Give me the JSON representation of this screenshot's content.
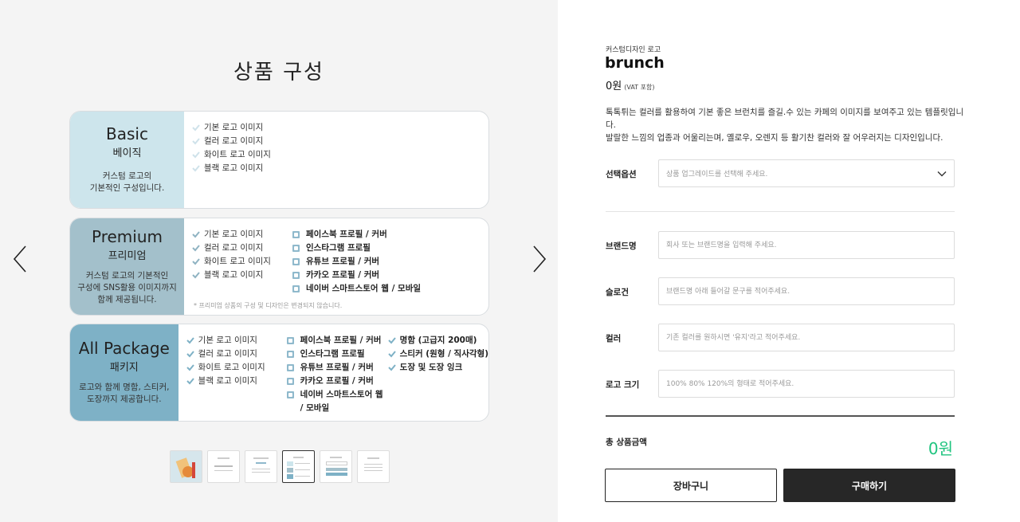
{
  "gallery": {
    "title": "상품 구성",
    "cards": [
      {
        "name_en": "Basic",
        "name_ko": "베이직",
        "desc_lines": [
          "커스텀 로고의",
          "기본적인 구성입니다."
        ],
        "items": [
          "기본 로고 이미지",
          "컬러 로고 이미지",
          "화이트 로고 이미지",
          "블랙 로고 이미지"
        ]
      },
      {
        "name_en": "Premium",
        "name_ko": "프리미엄",
        "desc_lines": [
          "커스텀 로고의 기본적인",
          "구성에 SNS활용 이미지까지",
          "함께 제공됩니다."
        ],
        "items": [
          "기본 로고 이미지",
          "컬러 로고 이미지",
          "화이트 로고 이미지",
          "블랙 로고 이미지"
        ],
        "sns_items": [
          "페이스북 프로필 / 커버",
          "인스타그램 프로필",
          "유튜브 프로필 / 커버",
          "카카오 프로필 / 커버",
          "네이버 스마트스토어 웹 / 모바일"
        ],
        "note": "* 프리미엄 상품의 구성 및 디자인은 변경되지 않습니다."
      },
      {
        "name_en": "All Package",
        "name_ko": "패키지",
        "desc_lines": [
          "로고와 함께 명함, 스티커,",
          "도장까지 제공합니다."
        ],
        "items": [
          "기본 로고 이미지",
          "컬러 로고 이미지",
          "화이트 로고 이미지",
          "블랙 로고 이미지"
        ],
        "sns_items": [
          "페이스북 프로필 / 커버",
          "인스타그램 프로필",
          "유튜브 프로필 / 커버",
          "카카오 프로필 / 커버",
          "네이버 스마트스토어 웹 / 모바일"
        ],
        "extra_items": [
          "명함 (고급지 200매)",
          "스티커 (원형 / 직사각형)",
          "도장 및 도장 잉크"
        ]
      }
    ],
    "thumbnail_count": 6,
    "active_thumbnail": 4,
    "check_color": "#7eb1c6",
    "highlight_color": "#a9d3ec"
  },
  "product": {
    "category": "커스텀디자인 로고",
    "name": "brunch",
    "price": "0원",
    "vat_note": "(VAT 포함)",
    "description_lines": [
      "톡톡튀는 컬러를 활용하여 기본 좋은 브런치를 즐길.수 있는 카페의 이미지를 보여주고 있는 템플릿입니다.",
      "발랄한 느낌의 업종과 어울리는며, 옐로우, 오렌지 등 활기찬 컬러와 잘 어우러지는 디자인입니다."
    ]
  },
  "form": {
    "option_label": "선택옵션",
    "option_placeholder": "상품 업그레이드를 선택해 주세요.",
    "brand_label": "브랜드명",
    "brand_placeholder": "회사 또는 브랜드명을 입력해 주세요.",
    "slogan_label": "슬로건",
    "slogan_placeholder": "브랜드명 아래 들어갈 문구를 적어주세요.",
    "color_label": "컬러",
    "color_placeholder": "기존 컬러를 원하시면 '유지'라고 적어주세요.",
    "size_label": "로고 크기",
    "size_placeholder": "100% 80% 120%의 형태로 적어주세요."
  },
  "summary": {
    "total_label": "총 상품금액",
    "total_value": "0원",
    "total_color": "#1fc47f",
    "cart_label": "장바구니",
    "buy_label": "구매하기"
  }
}
